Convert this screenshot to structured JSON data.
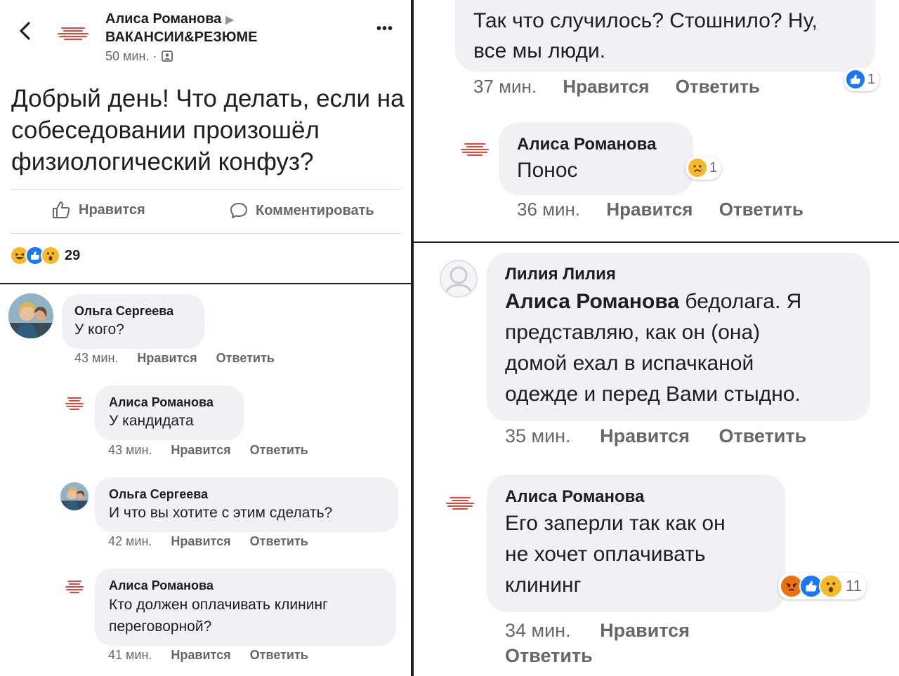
{
  "post": {
    "author": "Алиса Романова",
    "group_arrow": "▶",
    "group": "ВАКАНСИИ&РЕЗЮМЕ",
    "time": "50 мин. ·",
    "text": "Добрый день! Что делать, если на собеседовании произошёл физиологический конфуз?",
    "like_label": "Нравится",
    "comment_label": "Комментировать",
    "reactions_count": "29",
    "more_label": "•••",
    "back_label": "‹"
  },
  "thread_left": [
    {
      "name": "Ольга Сергеева",
      "text": "У кого?",
      "time": "43 мин.",
      "like": "Нравится",
      "reply": "Ответить"
    },
    {
      "name": "Алиса Романова",
      "text": "У кандидата",
      "time": "43 мин.",
      "like": "Нравится",
      "reply": "Ответить"
    },
    {
      "name": "Ольга Сергеева",
      "text": "И что вы хотите с этим сделать?",
      "time": "42 мин.",
      "like": "Нравится",
      "reply": "Ответить"
    },
    {
      "name": "Алиса Романова",
      "text_1": "Кто должен оплачивать клининг",
      "text_2": "переговорной?",
      "time": "41 мин.",
      "like": "Нравится",
      "reply": "Ответить"
    }
  ],
  "thread_top_right": [
    {
      "text_1": "Так что случилось? Стошнило? Ну,",
      "text_2": "все мы люди.",
      "time": "37 мин.",
      "like": "Нравится",
      "reply": "Ответить",
      "reaction_count": "1"
    },
    {
      "name": "Алиса Романова",
      "text": "Понос",
      "time": "36 мин.",
      "like": "Нравится",
      "reply": "Ответить",
      "reaction_count": "1"
    }
  ],
  "thread_bottom_right": [
    {
      "name": "Лилия Лилия",
      "mention": "Алиса Романова",
      "text_1": " бедолага. Я",
      "text_2": "представляю, как он (она)",
      "text_3": "домой ехал в испачканой",
      "text_4": "одежде и перед Вами стыдно.",
      "time": "35 мин.",
      "like": "Нравится",
      "reply": "Ответить"
    },
    {
      "name": "Алиса Романова",
      "text_1": "Его заперли так как он",
      "text_2": "не хочет оплачивать",
      "text_3": "клининг",
      "time": "34 мин.",
      "like": "Нравится",
      "reply": "Ответить",
      "reaction_count": "11"
    }
  ],
  "colors": {
    "like_blue": "#1877f2",
    "meta_gray": "#65676b",
    "bubble": "#eff1f4",
    "logo_red": "#e0463a"
  }
}
